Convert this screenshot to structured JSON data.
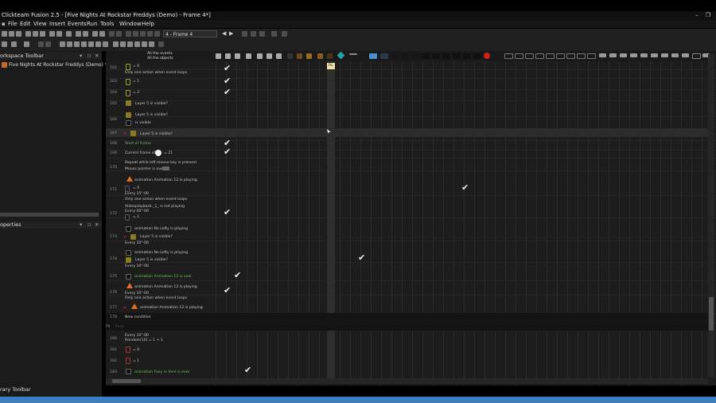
{
  "window": {
    "title": "Clickteam Fusion 2.5 - [Five Nights At Rockstar Freddys (Demo) - Frame 4*]"
  },
  "menu": [
    "File",
    "Edit",
    "View",
    "Insert",
    "Events",
    "Run",
    "Tools",
    "Window",
    "Help"
  ],
  "toolbar": {
    "frame_select": "4 - Frame 4"
  },
  "workspace": {
    "title": "orkspace Toolbar",
    "project": "Five Nights At Rockstar Freddys (Demo) *"
  },
  "properties": {
    "title": "operties"
  },
  "library": {
    "title": "rary Toolbar"
  },
  "editor": {
    "header_all_events": "All the events",
    "header_all_objects": "All the objects",
    "tooltip": "RL",
    "rows": [
      {
        "num": "162",
        "lines": [
          "= 0",
          "Only one action when event loops"
        ]
      },
      {
        "num": "163",
        "lines": [
          "= 1"
        ]
      },
      {
        "num": "164",
        "lines": [
          "= 2"
        ]
      },
      {
        "num": "165",
        "lines": [
          "Layer 5 is visible?"
        ]
      },
      {
        "num": "166",
        "lines": [
          "Layer 5 is visible?",
          "is visible"
        ]
      },
      {
        "num": "167",
        "lines": [
          "Layer 5 is visible?"
        ]
      },
      {
        "num": "168",
        "lines": [
          "Start of Frame"
        ]
      },
      {
        "num": "169",
        "lines": [
          "Current frame of",
          "= 21"
        ]
      },
      {
        "num": "170",
        "lines": [
          "Repeat while left mouse-key is pressed",
          "Mouse pointer is over"
        ]
      },
      {
        "num": "171",
        "lines": [
          "animation Animation 12 is playing",
          "Every 15\"-00",
          "= 0",
          "Only one action when event loops"
        ]
      },
      {
        "num": "172",
        "lines": [
          "Videoplayback-_1_ is not playing",
          "Every 00\"-00",
          "= 1"
        ]
      },
      {
        "num": "173",
        "lines": [
          "animation No Lefty is playing",
          "Layer 5 is visible?",
          "Every 10\"-00"
        ]
      },
      {
        "num": "174",
        "lines": [
          "animation No Lefty is playing",
          "Layer 5 is visible?",
          "Every 10\"-00"
        ]
      },
      {
        "num": "175",
        "lines": [
          "animation Animation 12 is over"
        ]
      },
      {
        "num": "176",
        "lines": [
          "animation Animation 12 is playing",
          "Every 10\"-00",
          "Only one action when event loops"
        ]
      },
      {
        "num": "177",
        "lines": [
          "animation Animation 12 is playing"
        ]
      },
      {
        "num": "178",
        "lines": [
          "New condition"
        ]
      },
      {
        "num": "179",
        "lines": [
          "Foxy"
        ]
      },
      {
        "num": "180",
        "lines": [
          "Every 10\"-00",
          "Random(10) = 1 + 1"
        ]
      },
      {
        "num": "181",
        "lines": [
          "= 0"
        ]
      },
      {
        "num": "182",
        "lines": [
          "= 1"
        ]
      },
      {
        "num": "183",
        "lines": [
          "animation Foxy in Vent is over"
        ]
      }
    ]
  }
}
